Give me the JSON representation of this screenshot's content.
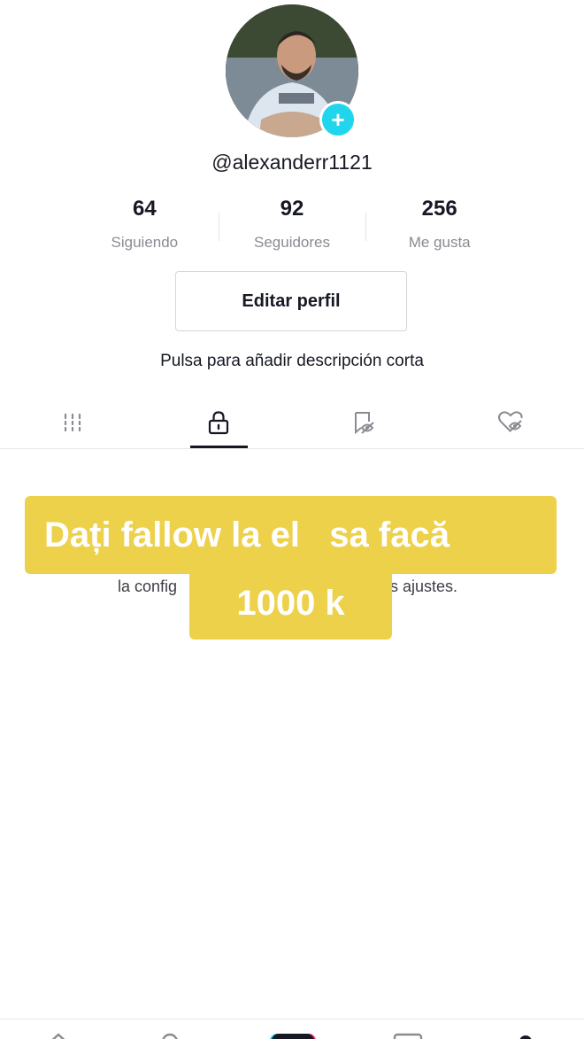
{
  "profile": {
    "username": "@alexanderr1121",
    "description_prompt": "Pulsa para añadir descripción corta",
    "edit_button_label": "Editar perfil"
  },
  "stats": [
    {
      "value": "64",
      "label": "Siguiendo"
    },
    {
      "value": "92",
      "label": "Seguidores"
    },
    {
      "value": "256",
      "label": "Me gusta"
    }
  ],
  "tabs": [
    {
      "icon": "grid-icon",
      "active": false
    },
    {
      "icon": "lock-icon",
      "active": true
    },
    {
      "icon": "bookmark-hidden-icon",
      "active": false
    },
    {
      "icon": "heart-hidden-icon",
      "active": false
    }
  ],
  "private_notice": {
    "left_visible": "la config",
    "right_visible": "s ajustes."
  },
  "overlay": {
    "line1": "Dați fallow la el   sa facă",
    "line2": "1000 k",
    "color": "#edd14a"
  },
  "bottom_nav": [
    "home-icon",
    "discover-icon",
    "create-icon",
    "inbox-icon",
    "profile-icon"
  ],
  "colors": {
    "accent": "#20d5ec",
    "text": "#161823",
    "muted": "#8a8b91"
  }
}
